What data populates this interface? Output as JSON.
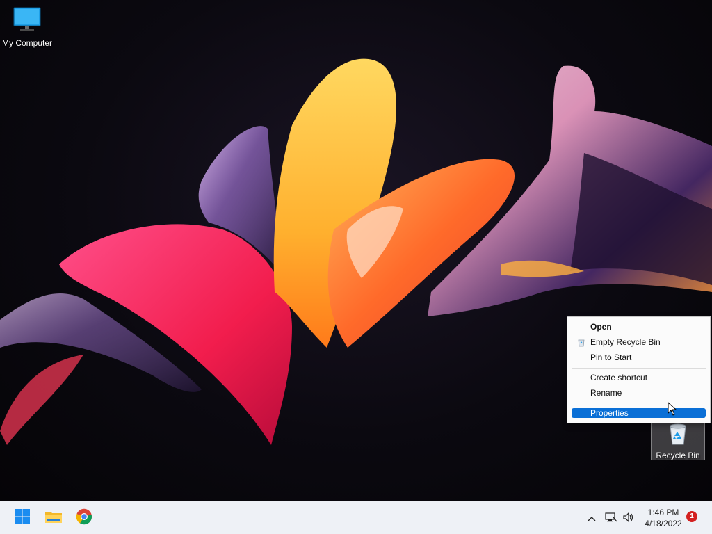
{
  "desktop": {
    "icons": [
      {
        "label": "My Computer",
        "icon": "monitor-icon"
      },
      {
        "label": "Recycle Bin",
        "icon": "recycle-bin-icon"
      }
    ]
  },
  "context_menu": {
    "items": [
      {
        "label": "Open",
        "bold": true
      },
      {
        "label": "Empty Recycle Bin",
        "icon": "recycle-small-icon"
      },
      {
        "label": "Pin to Start"
      },
      {
        "label": "Create shortcut"
      },
      {
        "label": "Rename"
      },
      {
        "label": "Properties",
        "selected": true
      }
    ]
  },
  "taskbar": {
    "apps": [
      {
        "name": "start",
        "icon": "windows-logo-icon"
      },
      {
        "name": "file-explorer",
        "icon": "folder-icon"
      },
      {
        "name": "chrome",
        "icon": "chrome-icon"
      }
    ],
    "tray": {
      "chevron_icon": "chevron-up-icon",
      "network_icon": "network-icon",
      "volume_icon": "volume-icon"
    },
    "clock": {
      "time": "1:46 PM",
      "date": "4/18/2022"
    },
    "notification_count": "1"
  },
  "colors": {
    "accent": "#0a6fd6",
    "taskbar_bg": "#eef1f6"
  }
}
